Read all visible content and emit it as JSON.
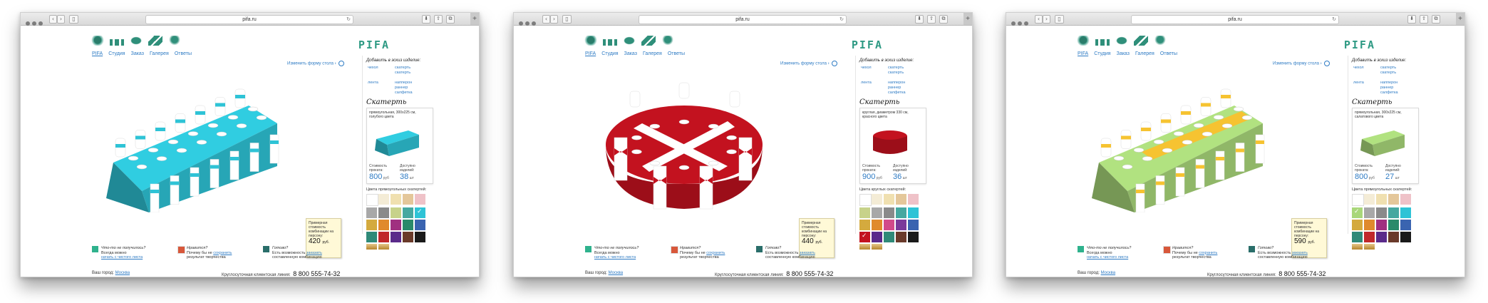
{
  "browser": {
    "url": "pifa.ru"
  },
  "site": {
    "brand": "PIFA",
    "nav": [
      "PIFA",
      "Студия",
      "Заказ",
      "Галерея",
      "Ответы"
    ],
    "change_form": "Изменить форму стола",
    "add_title": "Добавить в эскиз изделие:",
    "add_items": {
      "chehol": "чехол",
      "lenta": "лента",
      "skatert1": "скатерть",
      "skatert2": "скатерть",
      "napperon": "напперон",
      "ranner": "раннер",
      "salfetka": "салфетка"
    },
    "section": "Скатерть",
    "price_label1": "Стоимость проката:",
    "price_label2": "Доступно изделий:",
    "price_unit": "руб",
    "count_unit": "шт",
    "note_text": "Примерная стоимость комбинации на персону:",
    "note_unit": "руб.",
    "tip1_q": "Что-то не получилось?",
    "tip1_t": "Всегда можно",
    "tip1_a": "начать с чистого листа",
    "tip2_q": "Нравится?",
    "tip2_t": "Почему бы не",
    "tip2_a": "сохранить",
    "tip2_t2": "результат творчества",
    "tip3_q": "Готово?",
    "tip3_t": "Есть возможность",
    "tip3_a": "заказать",
    "tip3_t2": "составленную комбинацию",
    "city_label": "Ваш город:",
    "city": "Москва",
    "phone_label": "Круглосуточная клиентская линия:",
    "phone": "8 800 555-74-32"
  },
  "windows": [
    {
      "card_desc": "прямоугольная, 300х225 см, голубого цвета",
      "colors_title": "Цвета прямоугольных скатертей:",
      "price": "800",
      "count": "38",
      "person_price": "420",
      "accent": "#2ec3d6",
      "second": "#ffffff",
      "shape": "rect",
      "selected_swatch": 9,
      "swatches": [
        "#ffffff",
        "#f4ecd6",
        "#f0e0b0",
        "#e4c79a",
        "#efc2c8",
        "#a8a8a8",
        "#8a8a8a",
        "#c7d28a",
        "#46a8a0",
        "#2ec3d6",
        "#d4aa3e",
        "#e08a2c",
        "#a03080",
        "#2a8a6a",
        "#3a64b0",
        "#2f8a78",
        "#c0282a",
        "#5a2a8a",
        "#6a3a2a",
        "#1a1a1a"
      ]
    },
    {
      "card_desc": "круглая, диаметром 330 см, красного цвета",
      "colors_title": "Цвета круглых скатертей:",
      "price": "900",
      "count": "36",
      "person_price": "440",
      "accent": "#c3121f",
      "second": "#ffffff",
      "shape": "round",
      "selected_swatch": 15,
      "swatches": [
        "#ffffff",
        "#f4ecd6",
        "#f0e0b0",
        "#e4c79a",
        "#efc2c8",
        "#c7d28a",
        "#a8a8a8",
        "#8a8a8a",
        "#46a8a0",
        "#2ec3d6",
        "#d4aa3e",
        "#e08a2c",
        "#d24a8a",
        "#7a3a9a",
        "#3a64b0",
        "#c3121f",
        "#5a2a8a",
        "#2f8a78",
        "#6a3a2a",
        "#1a1a1a"
      ]
    },
    {
      "card_desc": "прямоугольная, 300х225 см, салатового цвета",
      "colors_title": "Цвета прямоугольных скатертей:",
      "price": "800",
      "count": "27",
      "person_price": "590",
      "accent": "#a9d77a",
      "second": "#f6c331",
      "shape": "rect",
      "selected_swatch": 5,
      "swatches": [
        "#ffffff",
        "#f4ecd6",
        "#f0e0b0",
        "#e4c79a",
        "#efc2c8",
        "#a9d77a",
        "#a8a8a8",
        "#8a8a8a",
        "#46a8a0",
        "#2ec3d6",
        "#d4aa3e",
        "#e08a2c",
        "#a03080",
        "#2a8a6a",
        "#3a64b0",
        "#2f8a78",
        "#c0282a",
        "#5a2a8a",
        "#6a3a2a",
        "#1a1a1a"
      ]
    }
  ]
}
